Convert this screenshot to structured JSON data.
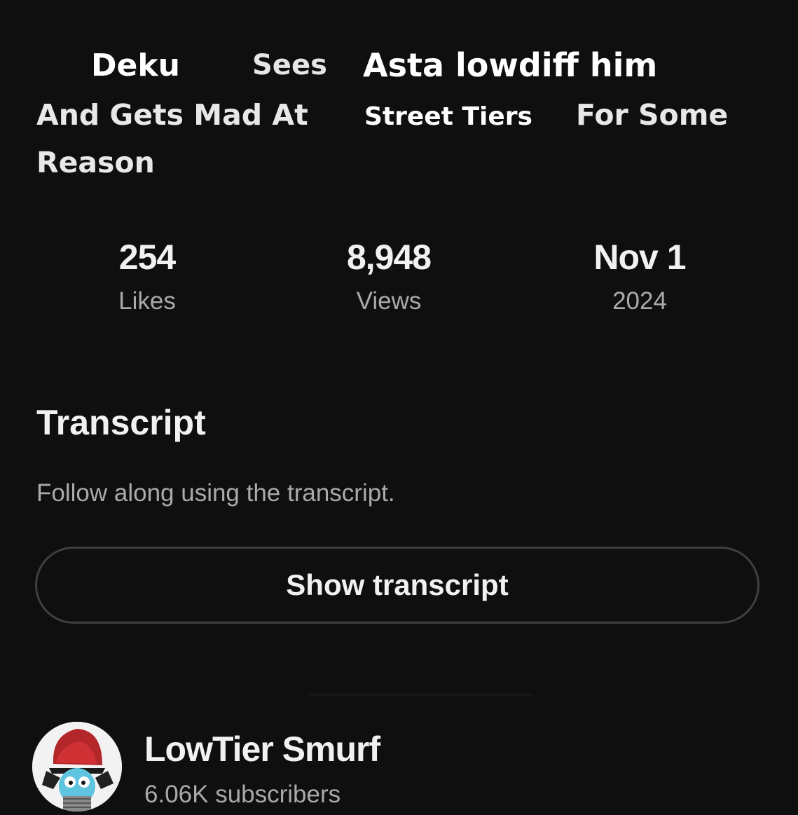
{
  "video": {
    "title_line1_a": "Deku",
    "title_line1_b": "Sees",
    "title_line1_c": "Asta lowdiff him",
    "title_line2_a": "And Gets Mad At",
    "title_line2_b": "Street Tiers",
    "title_line2_c": "For Some",
    "title_line3": "Reason"
  },
  "stats": {
    "likes_value": "254",
    "likes_label": "Likes",
    "views_value": "8,948",
    "views_label": "Views",
    "date_value": "Nov 1",
    "date_label": "2024"
  },
  "transcript": {
    "heading": "Transcript",
    "subtitle": "Follow along using the transcript.",
    "button_label": "Show transcript"
  },
  "channel": {
    "name": "LowTier Smurf",
    "subscribers": "6.06K subscribers",
    "avatar_icon": "cartoon-avatar-red-hat"
  },
  "colors": {
    "background": "#0f0f0f",
    "primary_text": "#f1f1f1",
    "secondary_text": "#aaaaaa",
    "button_border": "#3f3f3f"
  }
}
